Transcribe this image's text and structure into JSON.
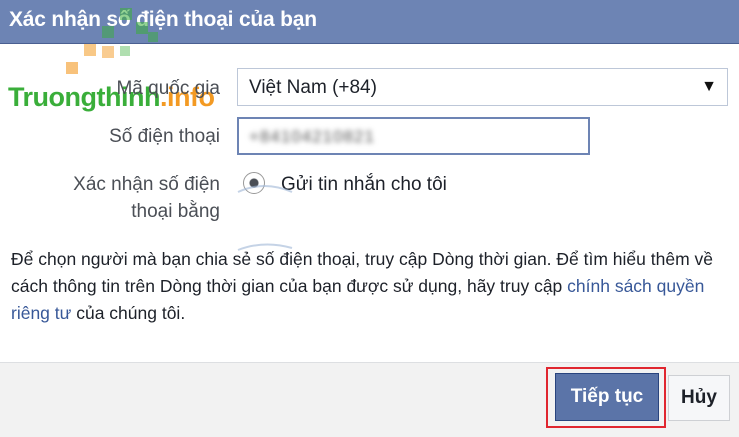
{
  "dialog": {
    "title": "Xác nhận số điện thoại của bạn"
  },
  "watermark": {
    "text_green": "Truongthinh",
    "text_orange": ".info"
  },
  "form": {
    "country_label": "Mã quốc gia",
    "country_value": "Việt Nam (+84)",
    "phone_label": "Số điện thoại",
    "phone_value": "+84104210821",
    "confirm_label_line1": "Xác nhận số điện",
    "confirm_label_line2": "thoại bằng",
    "radio_option": "Gửi tin nhắn cho tôi"
  },
  "info": {
    "text1": "Để chọn người mà bạn chia sẻ số điện thoại, truy cập Dòng thời gian. Để tìm hiểu thêm về cách thông tin trên Dòng thời gian của bạn được sử dụng, hãy truy cập ",
    "link": "chính sách quyền riêng tư",
    "text2": " của chúng tôi."
  },
  "buttons": {
    "continue": "Tiếp tục",
    "cancel": "Hủy"
  },
  "colors": {
    "header": "#6d84b4",
    "primary_button": "#5b74a8",
    "highlight": "#e0262f",
    "link": "#385898",
    "watermark_green": "#3aae3a",
    "watermark_orange": "#f39a23"
  }
}
